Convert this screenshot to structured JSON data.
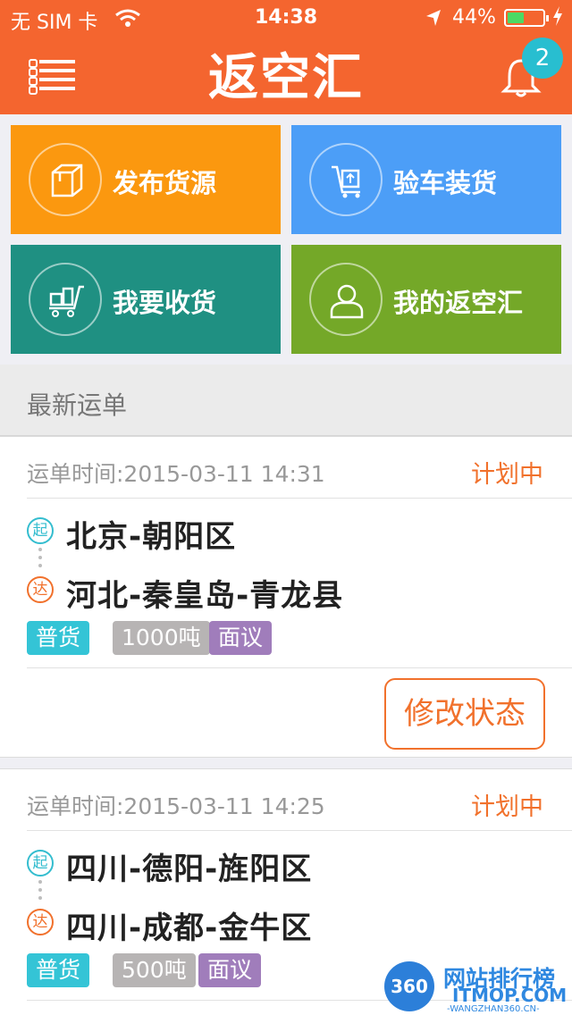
{
  "status_bar": {
    "carrier": "无 SIM 卡",
    "time": "14:38",
    "battery": "44%"
  },
  "header": {
    "title": "返空汇",
    "notification_count": "2"
  },
  "tiles": [
    {
      "label": "发布货源",
      "icon": "box-icon",
      "color": "#fb980f"
    },
    {
      "label": "验车装货",
      "icon": "cart-upload-icon",
      "color": "#4c9ef7"
    },
    {
      "label": "我要收货",
      "icon": "truck-cart-icon",
      "color": "#1f9082"
    },
    {
      "label": "我的返空汇",
      "icon": "user-icon",
      "color": "#74a828"
    }
  ],
  "section": {
    "title": "最新运单"
  },
  "orders": [
    {
      "time": "运单时间:2015-03-11 14:31",
      "status": "计划中",
      "start_mark": "起",
      "end_mark": "达",
      "from": "北京-朝阳区",
      "to": "河北-秦皇岛-青龙县",
      "tags": [
        "普货",
        "1000吨",
        "面议"
      ],
      "action": "修改状态"
    },
    {
      "time": "运单时间:2015-03-11 14:25",
      "status": "计划中",
      "start_mark": "起",
      "end_mark": "达",
      "from": "四川-德阳-旌阳区",
      "to": "四川-成都-金牛区",
      "tags": [
        "普货",
        "500吨",
        "面议"
      ]
    }
  ],
  "watermark": {
    "badge": "360",
    "name": "网站排行榜",
    "domain": "ITMOP.COM",
    "url": "-WANGZHAN360.CN-"
  }
}
